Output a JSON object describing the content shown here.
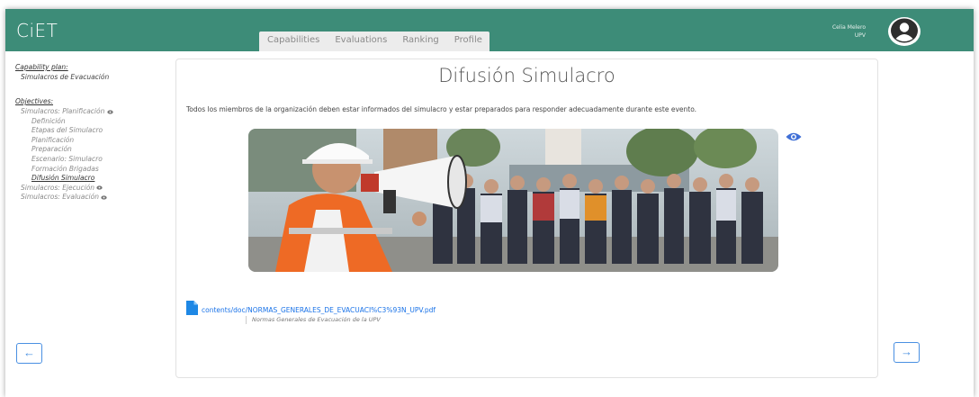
{
  "app": {
    "logo": "CiET"
  },
  "tabs": [
    {
      "label": "Capabilities"
    },
    {
      "label": "Evaluations"
    },
    {
      "label": "Ranking"
    },
    {
      "label": "Profile"
    }
  ],
  "user": {
    "name": "Celia Melero",
    "org": "UPV"
  },
  "sidebar": {
    "plan_heading": "Capability plan:",
    "plan_name": "Simulacros de Evacuación",
    "objectives_heading": "Objectives:",
    "items": [
      {
        "label": "Simulacros: Planificación",
        "level": 0
      },
      {
        "label": "Definición",
        "level": 1
      },
      {
        "label": "Etapas del Simulacro",
        "level": 1
      },
      {
        "label": "Planificación",
        "level": 1
      },
      {
        "label": "Preparación",
        "level": 1
      },
      {
        "label": "Escenario: Simulacro",
        "level": 1
      },
      {
        "label": "Formación Brigadas",
        "level": 1
      },
      {
        "label": "Difusión Simulacro",
        "level": 1
      },
      {
        "label": "Simulacros: Ejecución",
        "level": 0
      },
      {
        "label": "Simulacros: Evaluación",
        "level": 0
      }
    ]
  },
  "content": {
    "title": "Difusión Simulacro",
    "description": "Todos los miembros de la organización deben estar informados del simulacro y estar preparados para responder adecuadamente durante este evento.",
    "document": {
      "link": "contents/doc/NORMAS_GENERALES_DE_EVACUACI%C3%93N_UPV.pdf",
      "caption": "Normas Generales de Evacuación de la UPV"
    }
  },
  "nav": {
    "prev": "←",
    "next": "→"
  },
  "colors": {
    "topbar": "#3d8c78",
    "accent": "#4a90e2",
    "link": "#1a73e8"
  }
}
